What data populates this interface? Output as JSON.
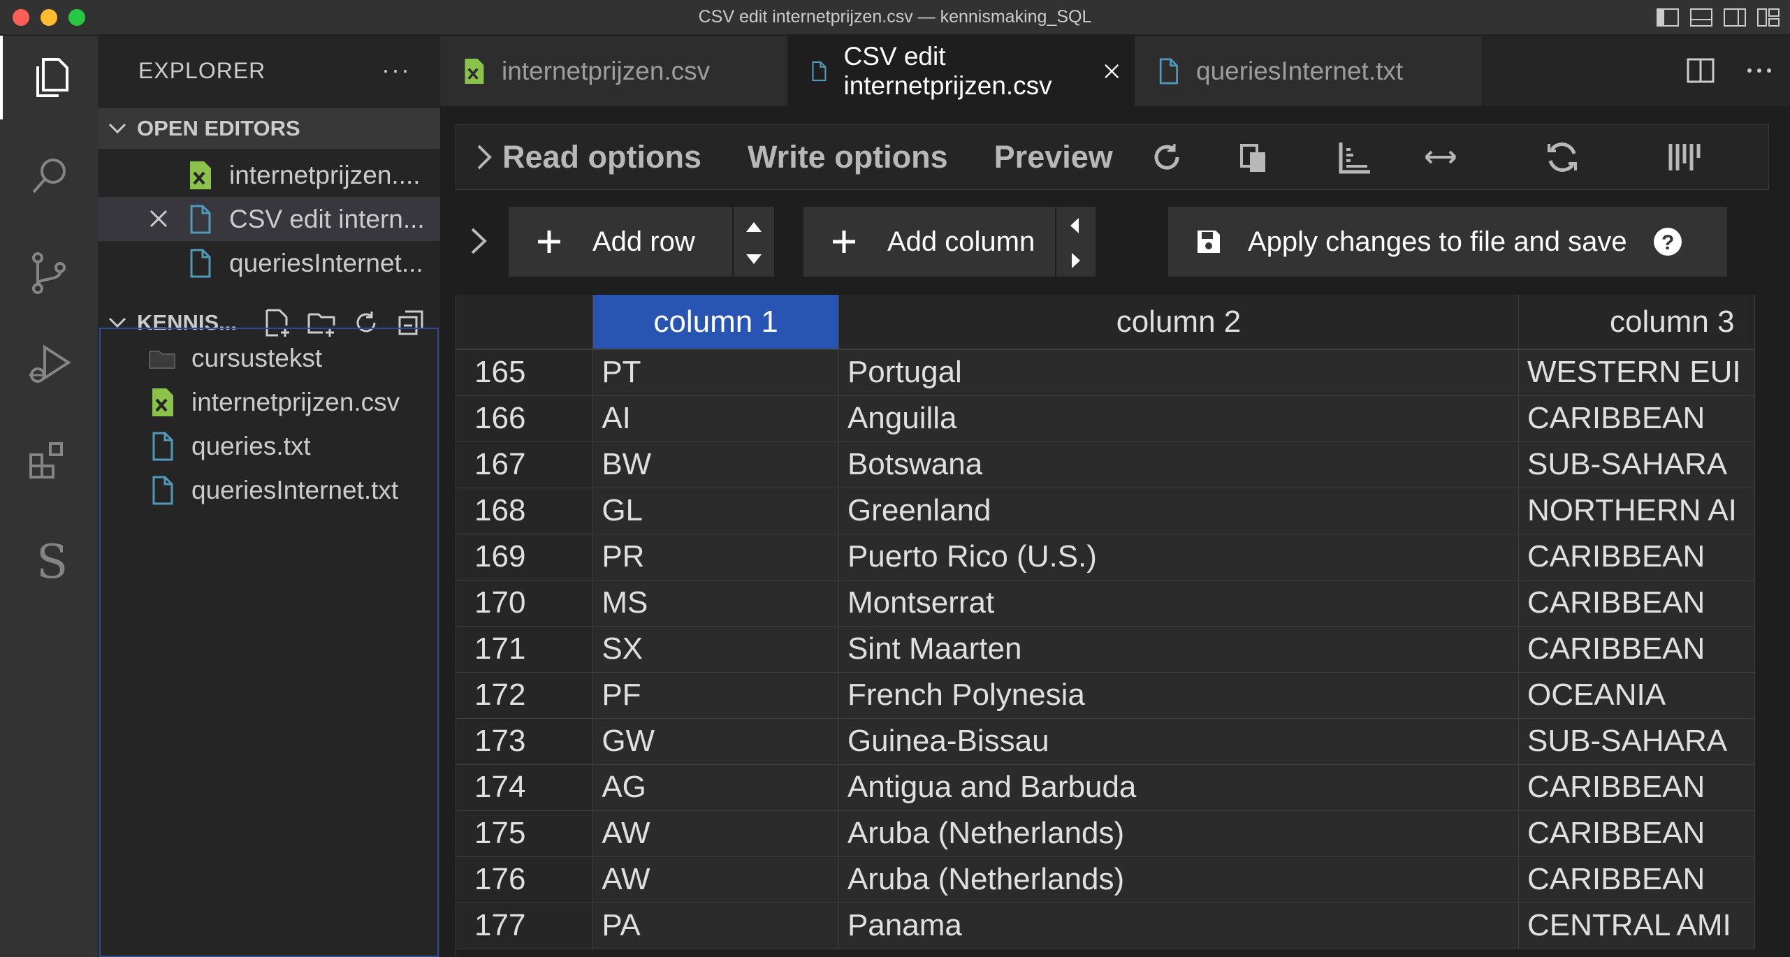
{
  "window": {
    "title": "CSV edit internetprijzen.csv — kennismaking_SQL"
  },
  "sidebar": {
    "header": "EXPLORER",
    "more": "···",
    "open_editors": {
      "title": "OPEN EDITORS",
      "items": [
        {
          "label": "internetprijzen...."
        },
        {
          "label": "CSV edit intern..."
        },
        {
          "label": "queriesInternet..."
        }
      ]
    },
    "folder": {
      "title": "KENNIS...",
      "items": [
        {
          "label": "cursustekst"
        },
        {
          "label": "internetprijzen.csv"
        },
        {
          "label": "queries.txt"
        },
        {
          "label": "queriesInternet.txt"
        }
      ]
    }
  },
  "tabs": [
    {
      "label": "internetprijzen.csv"
    },
    {
      "label": "CSV edit internetprijzen.csv"
    },
    {
      "label": "queriesInternet.txt"
    }
  ],
  "options": {
    "read": "Read options",
    "write": "Write options",
    "preview": "Preview"
  },
  "toolbar": {
    "add_row": "Add row",
    "add_column": "Add column",
    "apply": "Apply changes to file and save"
  },
  "grid": {
    "headers": [
      "",
      "column 1",
      "column 2",
      "column 3"
    ],
    "rows": [
      [
        "165",
        "PT",
        "Portugal",
        "WESTERN EUI"
      ],
      [
        "166",
        "AI",
        "Anguilla",
        "CARIBBEAN"
      ],
      [
        "167",
        "BW",
        "Botswana",
        "SUB-SAHARA"
      ],
      [
        "168",
        "GL",
        "Greenland",
        "NORTHERN AI"
      ],
      [
        "169",
        "PR",
        "Puerto Rico (U.S.)",
        "CARIBBEAN"
      ],
      [
        "170",
        "MS",
        "Montserrat",
        "CARIBBEAN"
      ],
      [
        "171",
        "SX",
        "Sint Maarten",
        "CARIBBEAN"
      ],
      [
        "172",
        "PF",
        "French Polynesia",
        "OCEANIA"
      ],
      [
        "173",
        "GW",
        "Guinea-Bissau",
        "SUB-SAHARA"
      ],
      [
        "174",
        "AG",
        "Antigua and Barbuda",
        "CARIBBEAN"
      ],
      [
        "175",
        "AW",
        "Aruba (Netherlands)",
        "CARIBBEAN"
      ],
      [
        "176",
        "AW",
        "Aruba (Netherlands)",
        "CARIBBEAN"
      ],
      [
        "177",
        "PA",
        "Panama",
        "CENTRAL AMI"
      ]
    ]
  },
  "colors": {
    "selected_header": "#2854b4",
    "csv_icon": "#8bc34a",
    "file_icon": "#519aba"
  }
}
